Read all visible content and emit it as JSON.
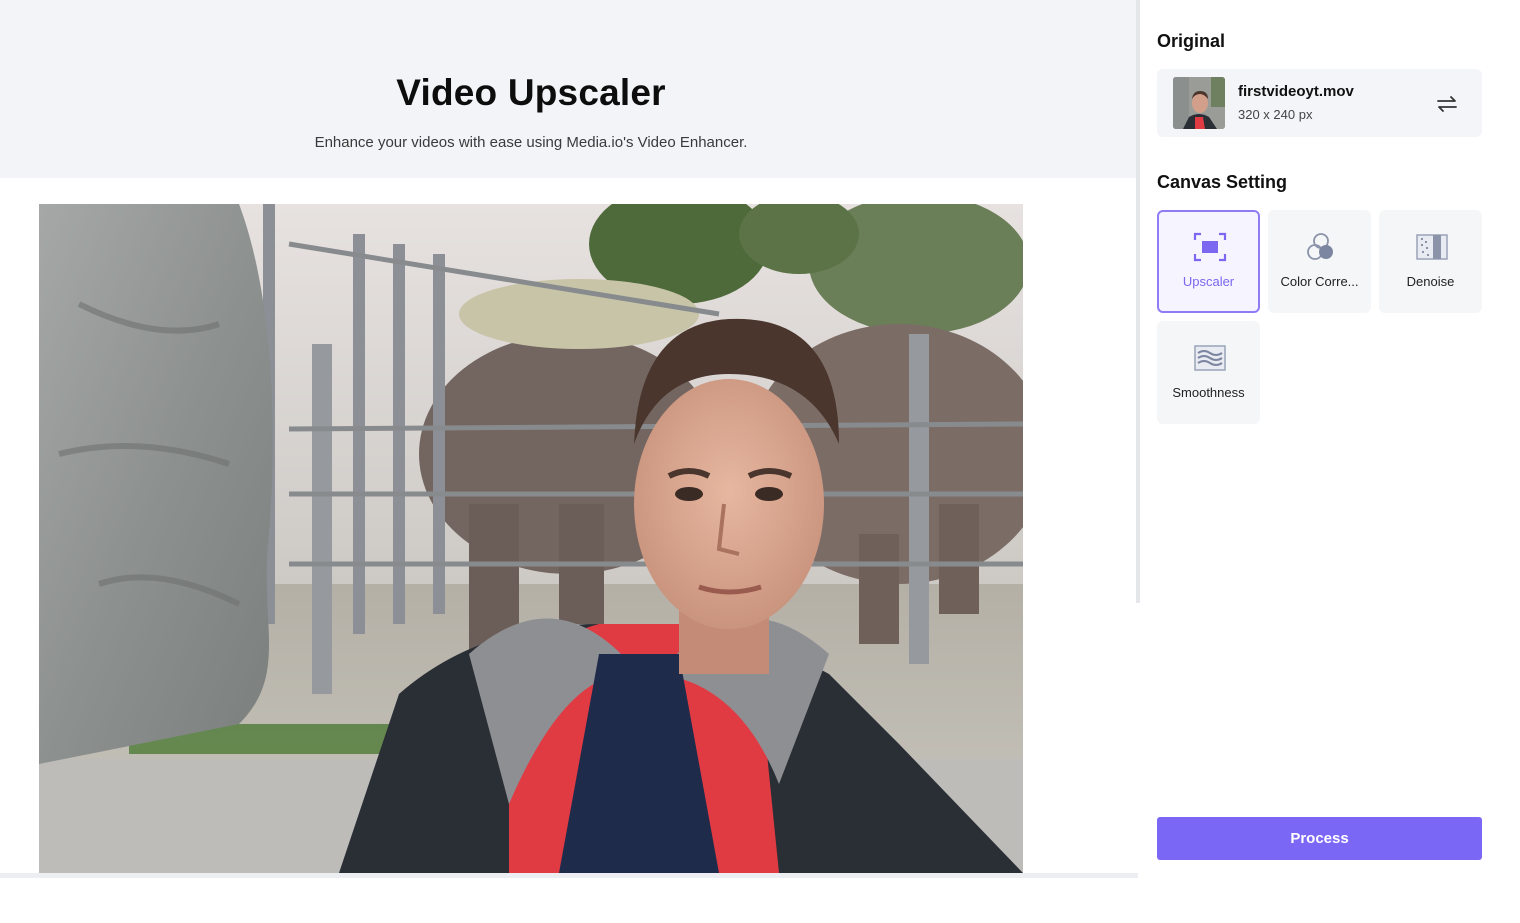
{
  "hero": {
    "title": "Video Upscaler",
    "subtitle": "Enhance your videos with ease using Media.io's Video Enhancer."
  },
  "panel": {
    "original_title": "Original",
    "file": {
      "name": "firstvideoyt.mov",
      "dimensions": "320 x 240 px",
      "swap_icon": "swap-arrows-icon"
    },
    "canvas_title": "Canvas Setting",
    "tools": [
      {
        "label": "Upscaler",
        "icon": "upscale-icon",
        "active": true
      },
      {
        "label": "Color Corre...",
        "icon": "color-circles-icon",
        "active": false
      },
      {
        "label": "Denoise",
        "icon": "denoise-icon",
        "active": false
      },
      {
        "label": "Smoothness",
        "icon": "smoothness-icon",
        "active": false
      }
    ],
    "process_label": "Process"
  },
  "colors": {
    "accent": "#7b67f6",
    "active_border": "#8f7cf5",
    "hero_bg": "#f3f4f8",
    "card_bg": "#f4f5f8"
  }
}
